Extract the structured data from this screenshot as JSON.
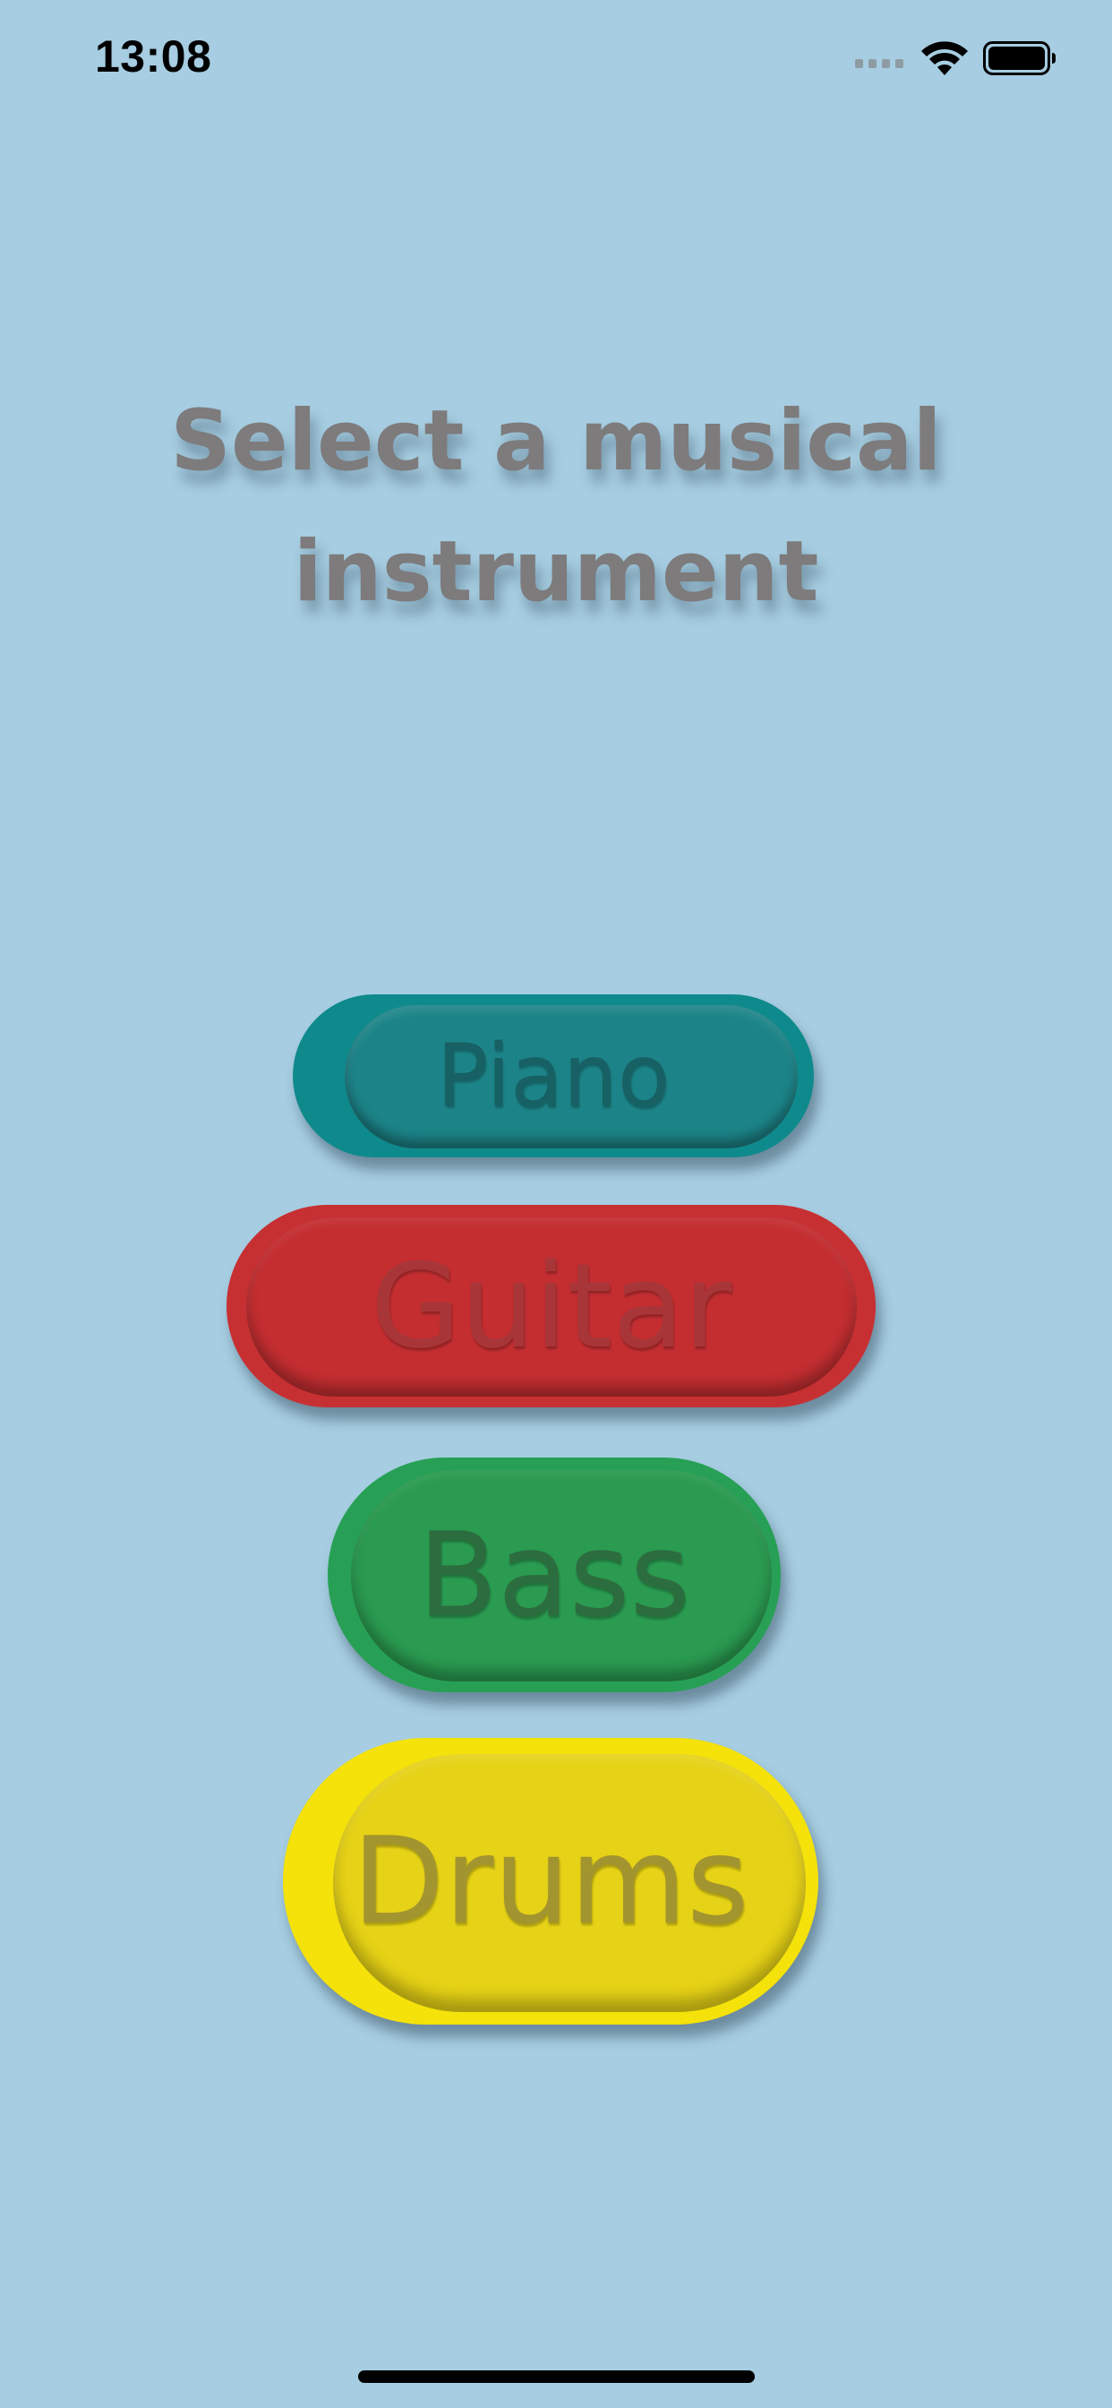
{
  "status_bar": {
    "time": "13:08",
    "icons": [
      "signal-icon",
      "wifi-icon",
      "battery-icon"
    ]
  },
  "title": {
    "line1": "Select a musical",
    "line2": "instrument"
  },
  "instruments": [
    {
      "label": "Piano",
      "color": "#0f8a8c"
    },
    {
      "label": "Guitar",
      "color": "#c73032"
    },
    {
      "label": "Bass",
      "color": "#27a055"
    },
    {
      "label": "Drums",
      "color": "#f4e20a"
    }
  ],
  "colors": {
    "background": "#a6cde1",
    "title_text": "#7d7b7c"
  }
}
